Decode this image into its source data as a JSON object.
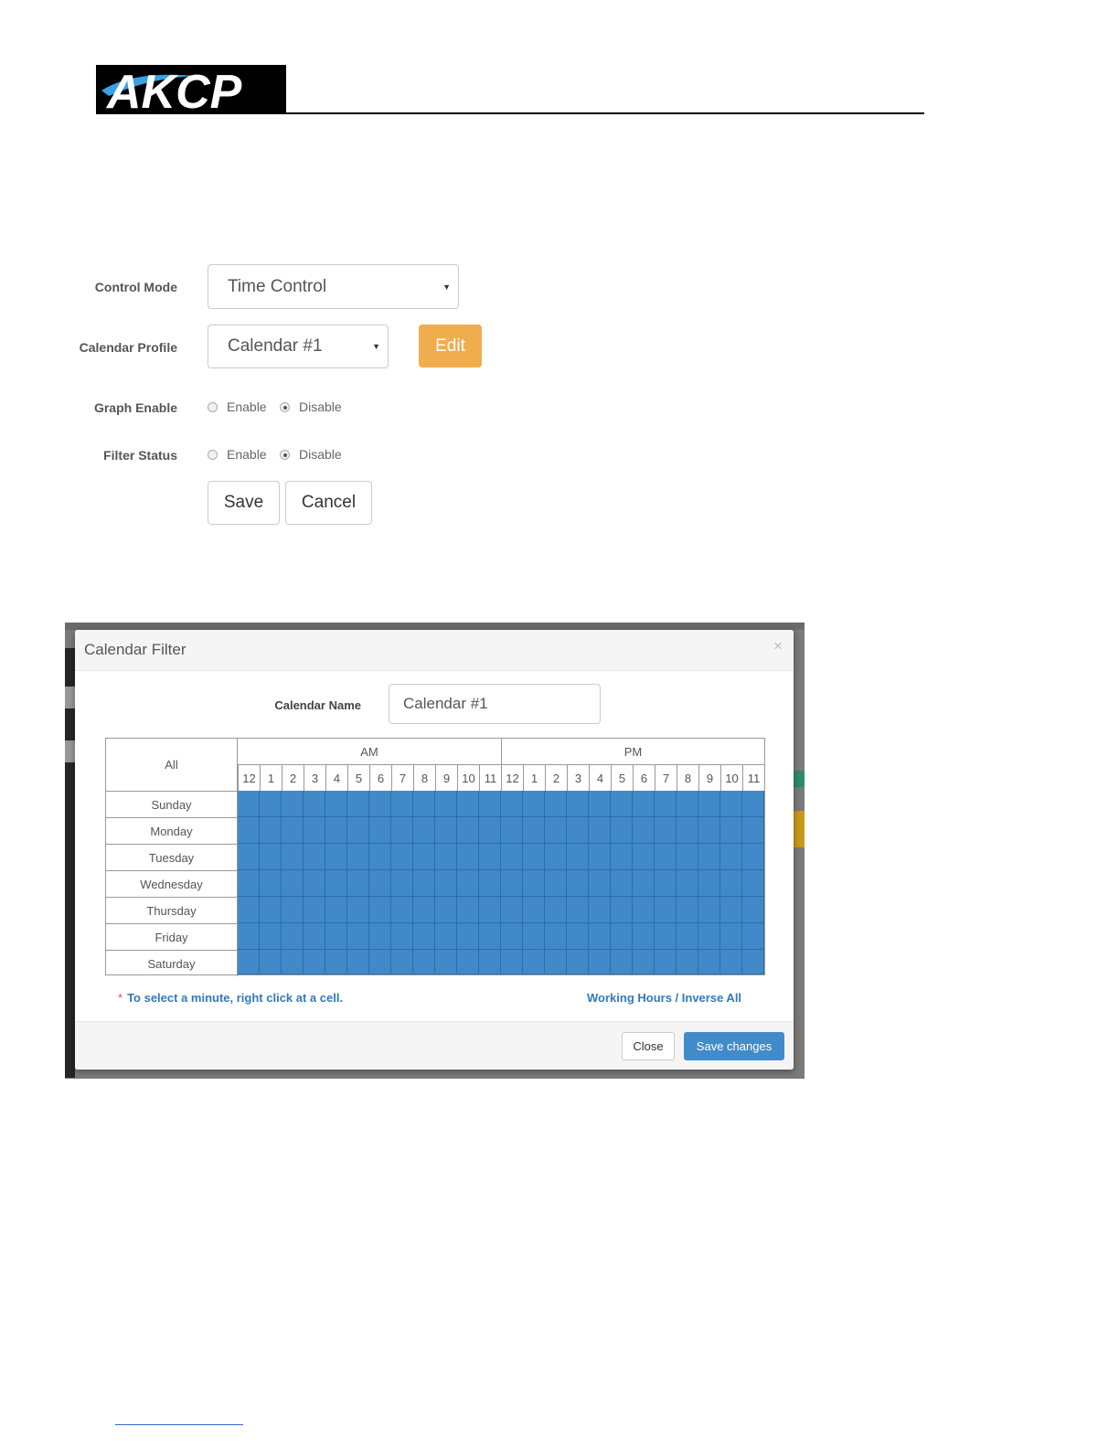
{
  "logo": {
    "text": "AKCP"
  },
  "form": {
    "control_mode": {
      "label": "Control Mode",
      "value": "Time Control"
    },
    "calendar_profile": {
      "label": "Calendar Profile",
      "value": "Calendar #1",
      "edit_label": "Edit"
    },
    "graph_enable": {
      "label": "Graph Enable",
      "options": [
        "Enable",
        "Disable"
      ],
      "selected": "Disable"
    },
    "filter_status": {
      "label": "Filter Status",
      "options": [
        "Enable",
        "Disable"
      ],
      "selected": "Disable"
    },
    "save_label": "Save",
    "cancel_label": "Cancel"
  },
  "modal": {
    "title": "Calendar Filter",
    "close_glyph": "×",
    "calendar_name_label": "Calendar Name",
    "calendar_name_value": "Calendar #1",
    "grid": {
      "all_label": "All",
      "am_label": "AM",
      "pm_label": "PM",
      "hours": [
        "12",
        "1",
        "2",
        "3",
        "4",
        "5",
        "6",
        "7",
        "8",
        "9",
        "10",
        "11"
      ],
      "days": [
        "Sunday",
        "Monday",
        "Tuesday",
        "Wednesday",
        "Thursday",
        "Friday",
        "Saturday"
      ],
      "fill_color": "#4189c9"
    },
    "hint_star": "*",
    "hint": "To select a minute, right click at a cell.",
    "working_hours_link": "Working Hours / Inverse All",
    "close_button": "Close",
    "save_button": "Save changes"
  },
  "colors": {
    "edit": "#f0ad4e",
    "primary": "#428bca",
    "link": "#337ab7"
  }
}
